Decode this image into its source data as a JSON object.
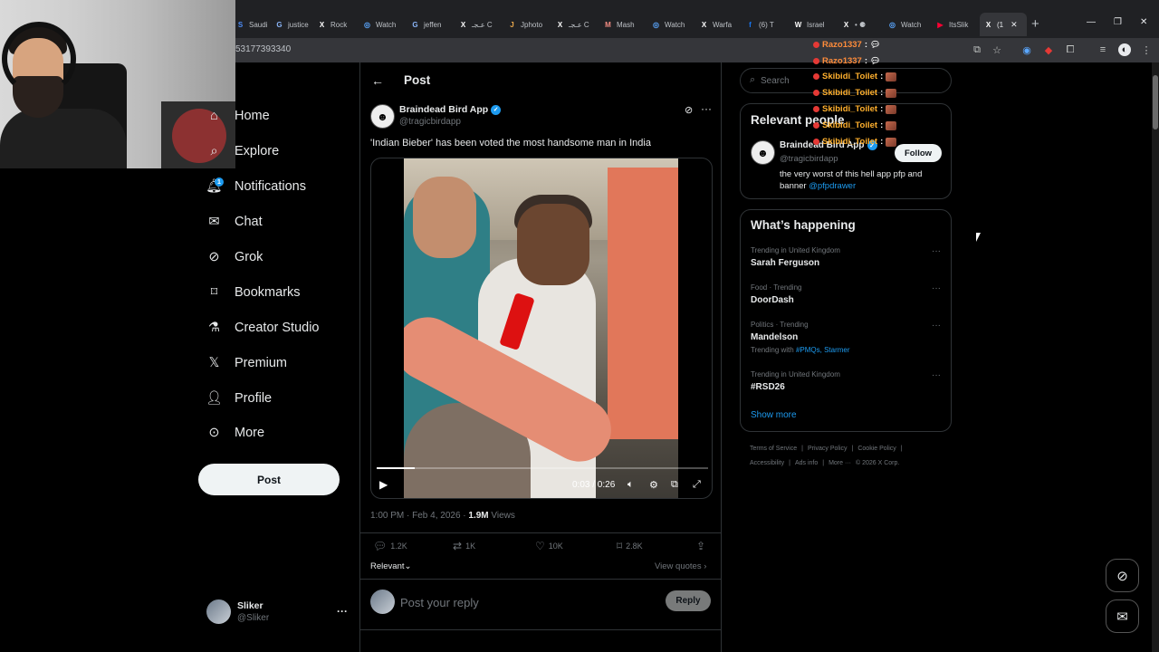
{
  "browser": {
    "tabs": [
      {
        "label": "Saudi",
        "fav": "S",
        "color": "#4c8bf5"
      },
      {
        "label": "justice",
        "fav": "G",
        "color": "#8ab4f8"
      },
      {
        "label": "Rock",
        "fav": "X",
        "color": "#ffffff"
      },
      {
        "label": "Watch",
        "fav": "◎",
        "color": "#5aa7ff"
      },
      {
        "label": "jeffen",
        "fav": "G",
        "color": "#8ab4f8"
      },
      {
        "label": "عـجـ C",
        "fav": "X",
        "color": "#ffffff"
      },
      {
        "label": "Jphoto",
        "fav": "J",
        "color": "#e9a84c"
      },
      {
        "label": "عـجـ C",
        "fav": "X",
        "color": "#ffffff"
      },
      {
        "label": "Mash",
        "fav": "M",
        "color": "#f28b82"
      },
      {
        "label": "Watch",
        "fav": "◎",
        "color": "#5aa7ff"
      },
      {
        "label": "Warfa",
        "fav": "X",
        "color": "#ffffff"
      },
      {
        "label": "(6) T",
        "fav": "f",
        "color": "#1877f2"
      },
      {
        "label": "Israel",
        "fav": "W",
        "color": "#ffffff"
      },
      {
        "label": "• ⚈",
        "fav": "X",
        "color": "#ffffff"
      },
      {
        "label": "Watch",
        "fav": "◎",
        "color": "#5aa7ff"
      },
      {
        "label": "ItsSlik",
        "fav": "▶",
        "color": "#ff0033"
      },
      {
        "label": "(1",
        "fav": "X",
        "color": "#ffffff",
        "active": true
      }
    ],
    "url": "53177393340"
  },
  "nav": {
    "items": [
      {
        "label": "Home",
        "icon": "home-icon"
      },
      {
        "label": "Explore",
        "icon": "search-icon"
      },
      {
        "label": "Notifications",
        "icon": "bell-icon"
      },
      {
        "label": "Chat",
        "icon": "mail-icon"
      },
      {
        "label": "Grok",
        "icon": "grok-icon"
      },
      {
        "label": "Bookmarks",
        "icon": "bookmark-icon"
      },
      {
        "label": "Creator Studio",
        "icon": "flask-icon"
      },
      {
        "label": "Premium",
        "icon": "x-logo-icon"
      },
      {
        "label": "Profile",
        "icon": "person-icon"
      },
      {
        "label": "More",
        "icon": "more-circle-icon"
      }
    ],
    "notification_count": "1",
    "post_button": "Post",
    "account": {
      "name": "Sliker",
      "handle": "@Sliker"
    }
  },
  "post": {
    "header_title": "Post",
    "author_name": "Braindead Bird App",
    "author_handle": "@tragicbirdapp",
    "text": "'Indian Bieber' has been voted the most handsome man in India",
    "video": {
      "time": "0:03 / 0:26",
      "progress": 0.115
    },
    "timestamp": "1:00 PM · Feb 4, 2026 · ",
    "views_count": "1.9M",
    "views_label": " Views",
    "replies": "1.2K",
    "reposts": "1K",
    "likes": "10K",
    "bookmarks": "2.8K",
    "sort_label": "Relevant",
    "view_quotes": "View quotes ›",
    "reply_placeholder": "Post your reply",
    "reply_button": "Reply"
  },
  "sidebar": {
    "search_placeholder": "Search",
    "relevant_title": "Relevant people",
    "relevant_person": {
      "name": "Braindead Bird App",
      "handle": "@tragicbirdapp",
      "bio": "the very worst of this hell app pfp and banner ",
      "bio_link": "@pfpdrawer",
      "follow_label": "Follow"
    },
    "happening_title": "What’s happening",
    "trends": [
      {
        "context": "Trending in United Kingdom",
        "title": "Sarah Ferguson",
        "with": ""
      },
      {
        "context": "Food · Trending",
        "title": "DoorDash",
        "with": ""
      },
      {
        "context": "Politics · Trending",
        "title": "Mandelson",
        "with_prefix": "Trending with ",
        "with": "#PMQs, Starmer"
      },
      {
        "context": "Trending in United Kingdom",
        "title": "#RSD26",
        "with": ""
      }
    ],
    "show_more": "Show more",
    "footer_row1": [
      "Terms of Service",
      "|",
      "Privacy Policy",
      "|",
      "Cookie Policy",
      "|"
    ],
    "footer_row2": [
      "Accessibility",
      "|",
      "Ads info",
      "|",
      "More ···",
      "© 2026 X Corp."
    ]
  },
  "chat_overlay": [
    {
      "user": "Razo1337",
      "color": "#ff8c3a",
      "sep": " :",
      "kind": "bubble"
    },
    {
      "user": "Razo1337",
      "color": "#ff8c3a",
      "sep": " :",
      "kind": "bubble"
    },
    {
      "user": "Skibidi_Toilet",
      "color": "#ffb02e",
      "sep": " :",
      "kind": "emote"
    },
    {
      "user": "Skibidi_Toilet",
      "color": "#ffb02e",
      "sep": " :",
      "kind": "emote"
    },
    {
      "user": "Skibidi_Toilet",
      "color": "#ffb02e",
      "sep": " :",
      "kind": "emote"
    },
    {
      "user": "Skibidi_Toilet",
      "color": "#ffb02e",
      "sep": " :",
      "kind": "emote"
    },
    {
      "user": "Skibidi_Toilet",
      "color": "#ffb02e",
      "sep": " :",
      "kind": "emote"
    }
  ],
  "colors": {
    "accent": "#1d9bf0",
    "background": "#000000",
    "border": "#2f3336",
    "muted": "#71767b"
  }
}
